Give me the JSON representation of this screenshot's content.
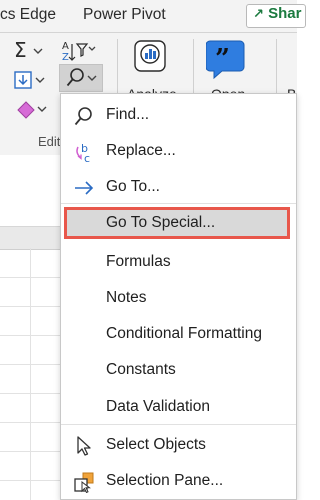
{
  "tabs": [
    {
      "label": "cs Edge"
    },
    {
      "label": "Power Pivot"
    }
  ],
  "share_label": "Shar",
  "ribbon": {
    "editing_group_label": "Edit",
    "analyze_label": "Analyze",
    "open_label": "Open",
    "trailing_label": "B"
  },
  "menu": {
    "items": [
      {
        "label": "Find...",
        "icon": "magnifier-icon"
      },
      {
        "label": "Replace...",
        "icon": "replace-icon"
      },
      {
        "label": "Go To...",
        "icon": "right-arrow-icon"
      },
      {
        "label": "Go To Special...",
        "icon": "",
        "highlighted": true
      },
      {
        "label": "Formulas"
      },
      {
        "label": "Notes"
      },
      {
        "label": "Conditional Formatting"
      },
      {
        "label": "Constants"
      },
      {
        "label": "Data Validation"
      },
      {
        "label": "Select Objects",
        "icon": "cursor-arrow-icon"
      },
      {
        "label": "Selection Pane...",
        "icon": "selection-pane-icon"
      }
    ]
  },
  "colors": {
    "highlight_border": "#e8574b",
    "highlight_fill": "#d9d9d9",
    "share_green": "#1b7a3f",
    "accent_blue": "#2b6cc4"
  }
}
